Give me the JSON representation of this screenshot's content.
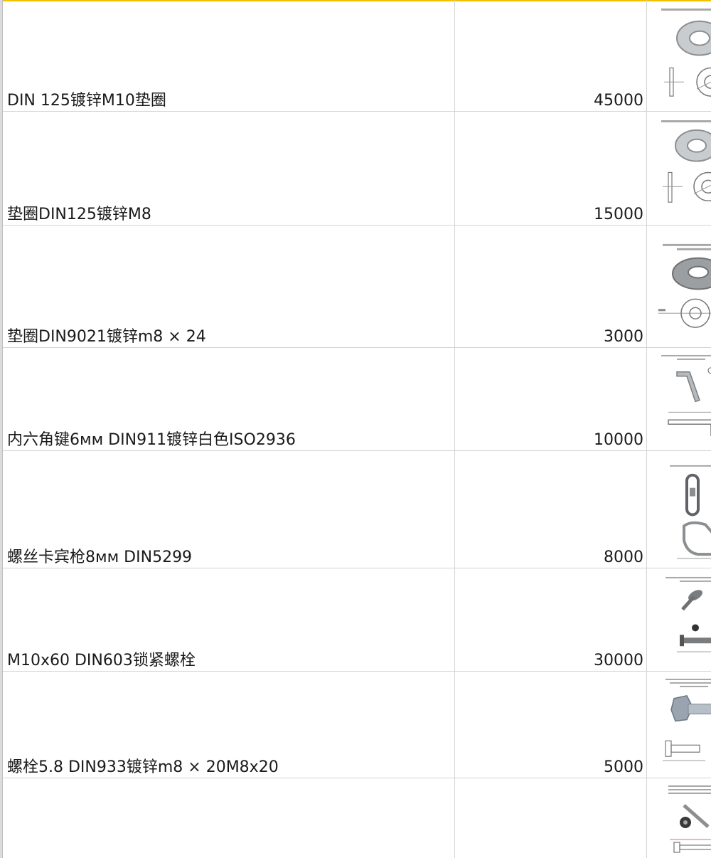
{
  "colors": {
    "accent": "#f2c200",
    "grid": "#d4d4d4",
    "text": "#1a1a1a"
  },
  "rows": [
    {
      "name": "DIN 125镀锌M10垫圈",
      "qty": "45000",
      "image_icon": "flat-washer-drawing-icon"
    },
    {
      "name": "垫圈DIN125镀锌M8",
      "qty": "15000",
      "image_icon": "flat-washer-drawing-icon"
    },
    {
      "name": "垫圈DIN9021镀锌m8 × 24",
      "qty": "3000",
      "image_icon": "wide-washer-drawing-icon"
    },
    {
      "name": "内六角键6мм DIN911镀锌白色ISO2936",
      "qty": "10000",
      "image_icon": "hex-key-drawing-icon"
    },
    {
      "name": "螺丝卡宾枪8мм DIN5299",
      "qty": "8000",
      "image_icon": "carabiner-drawing-icon"
    },
    {
      "name": "M10x60 DIN603锁紧螺栓",
      "qty": "30000",
      "image_icon": "carriage-bolt-drawing-icon"
    },
    {
      "name": "螺栓5.8 DIN933镀锌m8 × 20M8x20",
      "qty": "5000",
      "image_icon": "hex-bolt-drawing-icon"
    },
    {
      "name": "",
      "qty": "",
      "image_icon": "socket-screw-drawing-icon"
    }
  ]
}
